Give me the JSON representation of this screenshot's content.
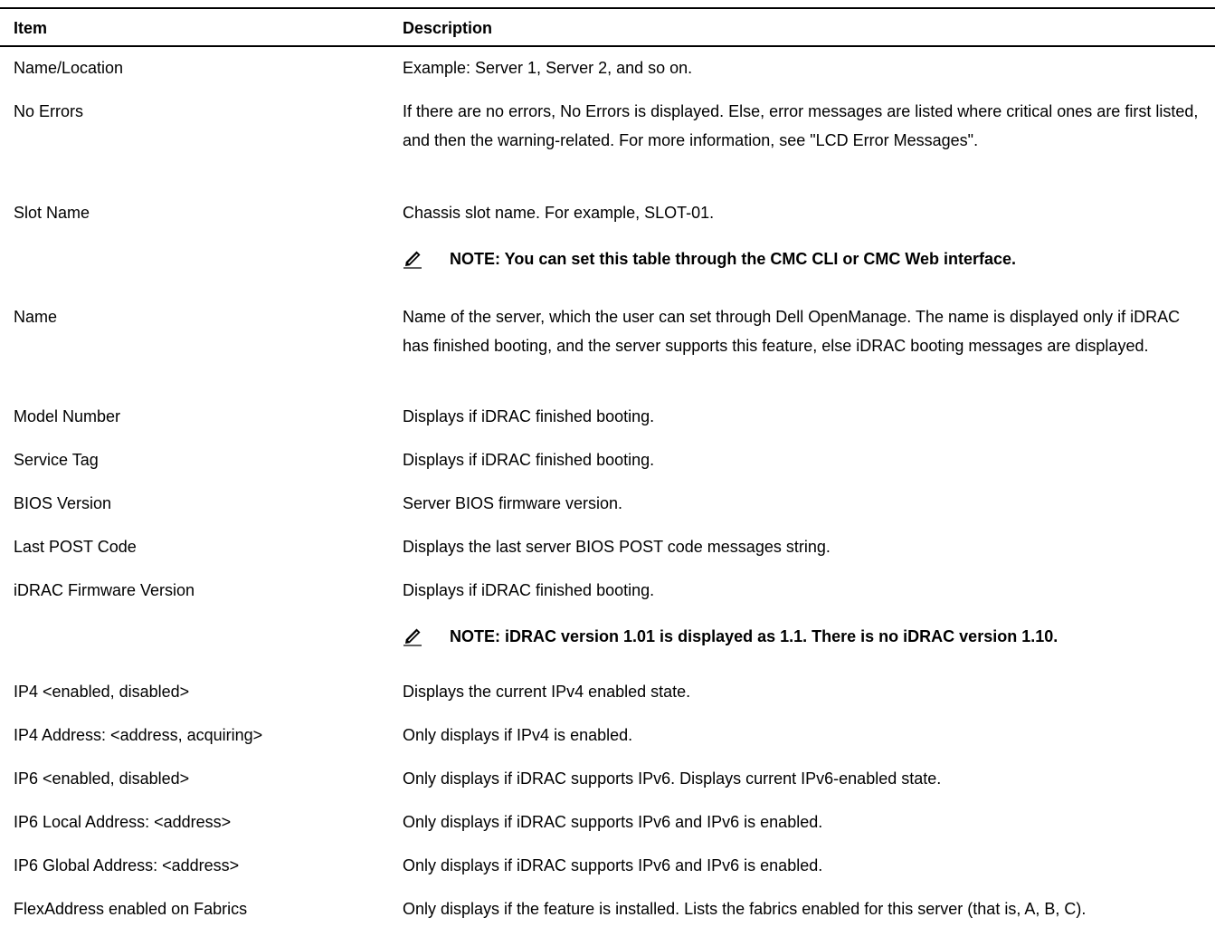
{
  "table": {
    "header": {
      "item": "Item",
      "description": "Description"
    },
    "rows": [
      {
        "item": "Name/Location",
        "description": "Example: Server 1, Server 2, and so on."
      },
      {
        "item": "No Errors",
        "description": "If there are no errors, No Errors is displayed. Else, error messages are listed where critical ones are first listed, and then the warning-related. For more information, see \"LCD Error Messages\"."
      },
      {
        "item": "Slot Name",
        "description": "Chassis slot name. For example, SLOT-01.",
        "note": "NOTE: You can set this table through the CMC CLI or CMC Web interface."
      },
      {
        "item": "Name",
        "description": "Name of the server, which the user can set through Dell OpenManage. The name is displayed only if iDRAC has finished booting, and the server supports this feature, else iDRAC booting messages are displayed."
      },
      {
        "item": "Model Number",
        "description": "Displays if iDRAC finished booting."
      },
      {
        "item": "Service Tag",
        "description": "Displays if iDRAC finished booting."
      },
      {
        "item": "BIOS Version",
        "description": "Server BIOS firmware version."
      },
      {
        "item": "Last POST Code",
        "description": "Displays the last server BIOS POST code messages string."
      },
      {
        "item": "iDRAC Firmware Version",
        "description": "Displays if iDRAC finished booting.",
        "note": "NOTE: iDRAC version 1.01 is displayed as 1.1. There is no iDRAC version 1.10."
      },
      {
        "item": "IP4 <enabled, disabled>",
        "description": "Displays the current IPv4 enabled state."
      },
      {
        "item": "IP4 Address: <address, acquiring>",
        "description": "Only displays if IPv4 is enabled."
      },
      {
        "item": "IP6 <enabled, disabled>",
        "description": "Only displays if iDRAC supports IPv6. Displays current IPv6-enabled state."
      },
      {
        "item": "IP6 Local Address: <address>",
        "description": "Only displays if iDRAC supports IPv6 and IPv6 is enabled."
      },
      {
        "item": "IP6 Global Address: <address>",
        "description": "Only displays if iDRAC supports IPv6 and IPv6 is enabled."
      },
      {
        "item": "FlexAddress enabled on Fabrics",
        "description": "Only displays if the feature is installed. Lists the fabrics enabled for this server (that is, A, B, C)."
      }
    ],
    "note_icon": "pencil-note-icon"
  }
}
